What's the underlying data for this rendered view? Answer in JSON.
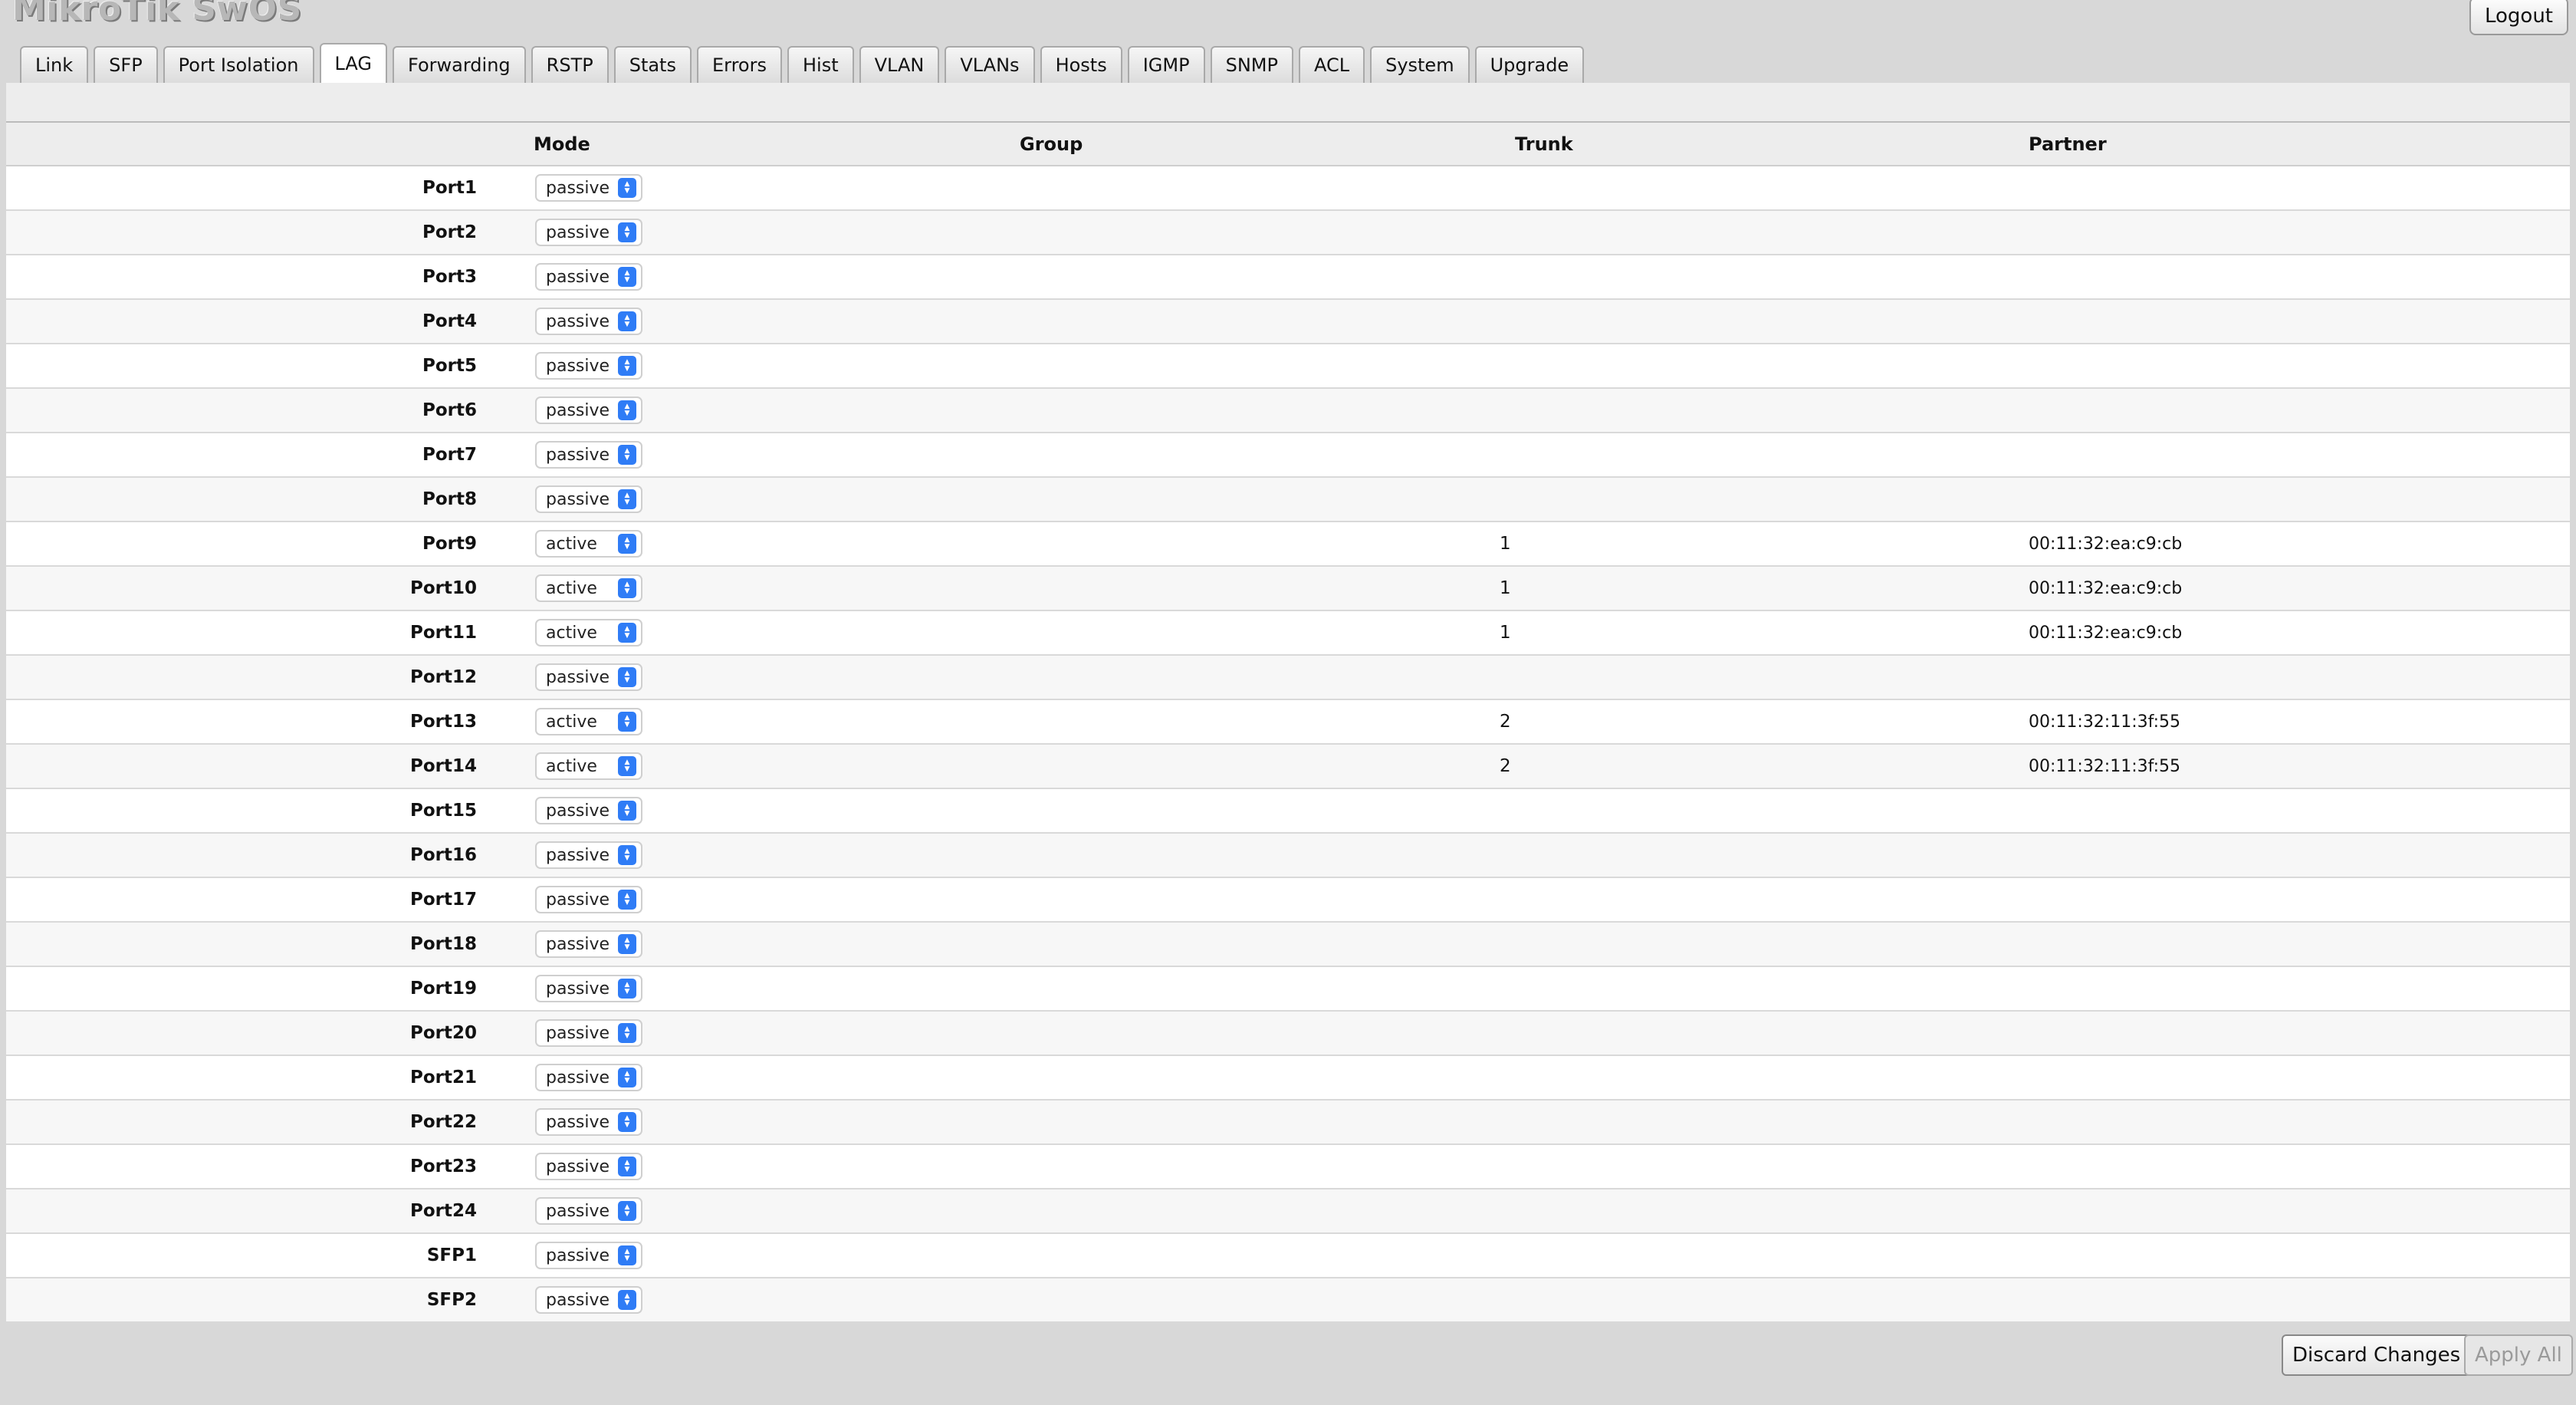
{
  "app": {
    "title": "MikroTik SwOS",
    "logout_label": "Logout"
  },
  "tabs": [
    {
      "label": "Link"
    },
    {
      "label": "SFP"
    },
    {
      "label": "Port Isolation"
    },
    {
      "label": "LAG",
      "active": true
    },
    {
      "label": "Forwarding"
    },
    {
      "label": "RSTP"
    },
    {
      "label": "Stats"
    },
    {
      "label": "Errors"
    },
    {
      "label": "Hist"
    },
    {
      "label": "VLAN"
    },
    {
      "label": "VLANs"
    },
    {
      "label": "Hosts"
    },
    {
      "label": "IGMP"
    },
    {
      "label": "SNMP"
    },
    {
      "label": "ACL"
    },
    {
      "label": "System"
    },
    {
      "label": "Upgrade"
    }
  ],
  "table": {
    "headers": {
      "mode": "Mode",
      "group": "Group",
      "trunk": "Trunk",
      "partner": "Partner"
    },
    "rows": [
      {
        "port": "Port1",
        "mode": "passive",
        "group": "",
        "trunk": "",
        "partner": ""
      },
      {
        "port": "Port2",
        "mode": "passive",
        "group": "",
        "trunk": "",
        "partner": ""
      },
      {
        "port": "Port3",
        "mode": "passive",
        "group": "",
        "trunk": "",
        "partner": ""
      },
      {
        "port": "Port4",
        "mode": "passive",
        "group": "",
        "trunk": "",
        "partner": ""
      },
      {
        "port": "Port5",
        "mode": "passive",
        "group": "",
        "trunk": "",
        "partner": ""
      },
      {
        "port": "Port6",
        "mode": "passive",
        "group": "",
        "trunk": "",
        "partner": ""
      },
      {
        "port": "Port7",
        "mode": "passive",
        "group": "",
        "trunk": "",
        "partner": ""
      },
      {
        "port": "Port8",
        "mode": "passive",
        "group": "",
        "trunk": "",
        "partner": ""
      },
      {
        "port": "Port9",
        "mode": "active",
        "group": "",
        "trunk": "1",
        "partner": "00:11:32:ea:c9:cb"
      },
      {
        "port": "Port10",
        "mode": "active",
        "group": "",
        "trunk": "1",
        "partner": "00:11:32:ea:c9:cb"
      },
      {
        "port": "Port11",
        "mode": "active",
        "group": "",
        "trunk": "1",
        "partner": "00:11:32:ea:c9:cb"
      },
      {
        "port": "Port12",
        "mode": "passive",
        "group": "",
        "trunk": "",
        "partner": ""
      },
      {
        "port": "Port13",
        "mode": "active",
        "group": "",
        "trunk": "2",
        "partner": "00:11:32:11:3f:55"
      },
      {
        "port": "Port14",
        "mode": "active",
        "group": "",
        "trunk": "2",
        "partner": "00:11:32:11:3f:55"
      },
      {
        "port": "Port15",
        "mode": "passive",
        "group": "",
        "trunk": "",
        "partner": ""
      },
      {
        "port": "Port16",
        "mode": "passive",
        "group": "",
        "trunk": "",
        "partner": ""
      },
      {
        "port": "Port17",
        "mode": "passive",
        "group": "",
        "trunk": "",
        "partner": ""
      },
      {
        "port": "Port18",
        "mode": "passive",
        "group": "",
        "trunk": "",
        "partner": ""
      },
      {
        "port": "Port19",
        "mode": "passive",
        "group": "",
        "trunk": "",
        "partner": ""
      },
      {
        "port": "Port20",
        "mode": "passive",
        "group": "",
        "trunk": "",
        "partner": ""
      },
      {
        "port": "Port21",
        "mode": "passive",
        "group": "",
        "trunk": "",
        "partner": ""
      },
      {
        "port": "Port22",
        "mode": "passive",
        "group": "",
        "trunk": "",
        "partner": ""
      },
      {
        "port": "Port23",
        "mode": "passive",
        "group": "",
        "trunk": "",
        "partner": ""
      },
      {
        "port": "Port24",
        "mode": "passive",
        "group": "",
        "trunk": "",
        "partner": ""
      },
      {
        "port": "SFP1",
        "mode": "passive",
        "group": "",
        "trunk": "",
        "partner": ""
      },
      {
        "port": "SFP2",
        "mode": "passive",
        "group": "",
        "trunk": "",
        "partner": ""
      }
    ]
  },
  "footer": {
    "discard_label": "Discard Changes",
    "apply_label": "Apply All"
  },
  "colors": {
    "select_arrow": "#2f7cf6",
    "background": "#d8d8d8"
  },
  "icons": {
    "select_arrow": "updown-chevron-icon"
  }
}
